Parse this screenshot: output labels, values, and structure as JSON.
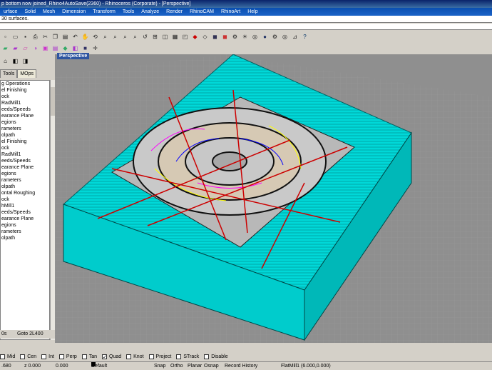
{
  "window": {
    "title": "p bottom now joined_Rhino4AutoSave(2360) - Rhinoceros (Corporate) - [Perspective]"
  },
  "menu": [
    "urface",
    "Solid",
    "Mesh",
    "Dimension",
    "Transform",
    "Tools",
    "Analyze",
    "Render",
    "RhinoCAM",
    "RhinoArt",
    "Help"
  ],
  "command": {
    "history": "30 surfaces.",
    "input": ""
  },
  "panel": {
    "tabs": [
      "Tools",
      "MOps"
    ],
    "tree": [
      "g Operations",
      "el Finishing",
      "ock",
      "RadMill1",
      "eeds/Speeds",
      "earance Plane",
      "egions",
      "rameters",
      "olpath",
      "el Finishing",
      "ock",
      "RadMill1",
      "eeds/Speeds",
      "earance Plane",
      "egions",
      "rameters",
      "olpath",
      "ontal Roughing",
      "ock",
      "hMill1",
      "eeds/Speeds",
      "earance Plane",
      "egions",
      "rameters",
      "olpath"
    ],
    "footer_left": "0s",
    "footer_goto": "Goto 2L400"
  },
  "viewport": {
    "label": "Perspective"
  },
  "osnap": {
    "items": [
      {
        "label": "Mid",
        "checked": false
      },
      {
        "label": "Cen",
        "checked": false
      },
      {
        "label": "Int",
        "checked": false
      },
      {
        "label": "Perp",
        "checked": false
      },
      {
        "label": "Tan",
        "checked": false
      },
      {
        "label": "Quad",
        "checked": true
      },
      {
        "label": "Knot",
        "checked": false
      },
      {
        "label": "Project",
        "checked": false
      },
      {
        "label": "STrack",
        "checked": false
      },
      {
        "label": "Disable",
        "checked": false
      }
    ]
  },
  "status": {
    "x": ".680",
    "y": "z 0.000",
    "z": "0.000",
    "layer": "Default",
    "snap": "Snap",
    "ortho": "Ortho",
    "planar": "Planar",
    "osnap": "Osnap",
    "record": "Record History",
    "tool": "FlatMill1 (6.000,0.000)"
  },
  "colors": {
    "viewport": "#8f8f8f",
    "toolpath": "#00e5e5",
    "stock_edge": "#000000",
    "title": "#0a246a"
  }
}
